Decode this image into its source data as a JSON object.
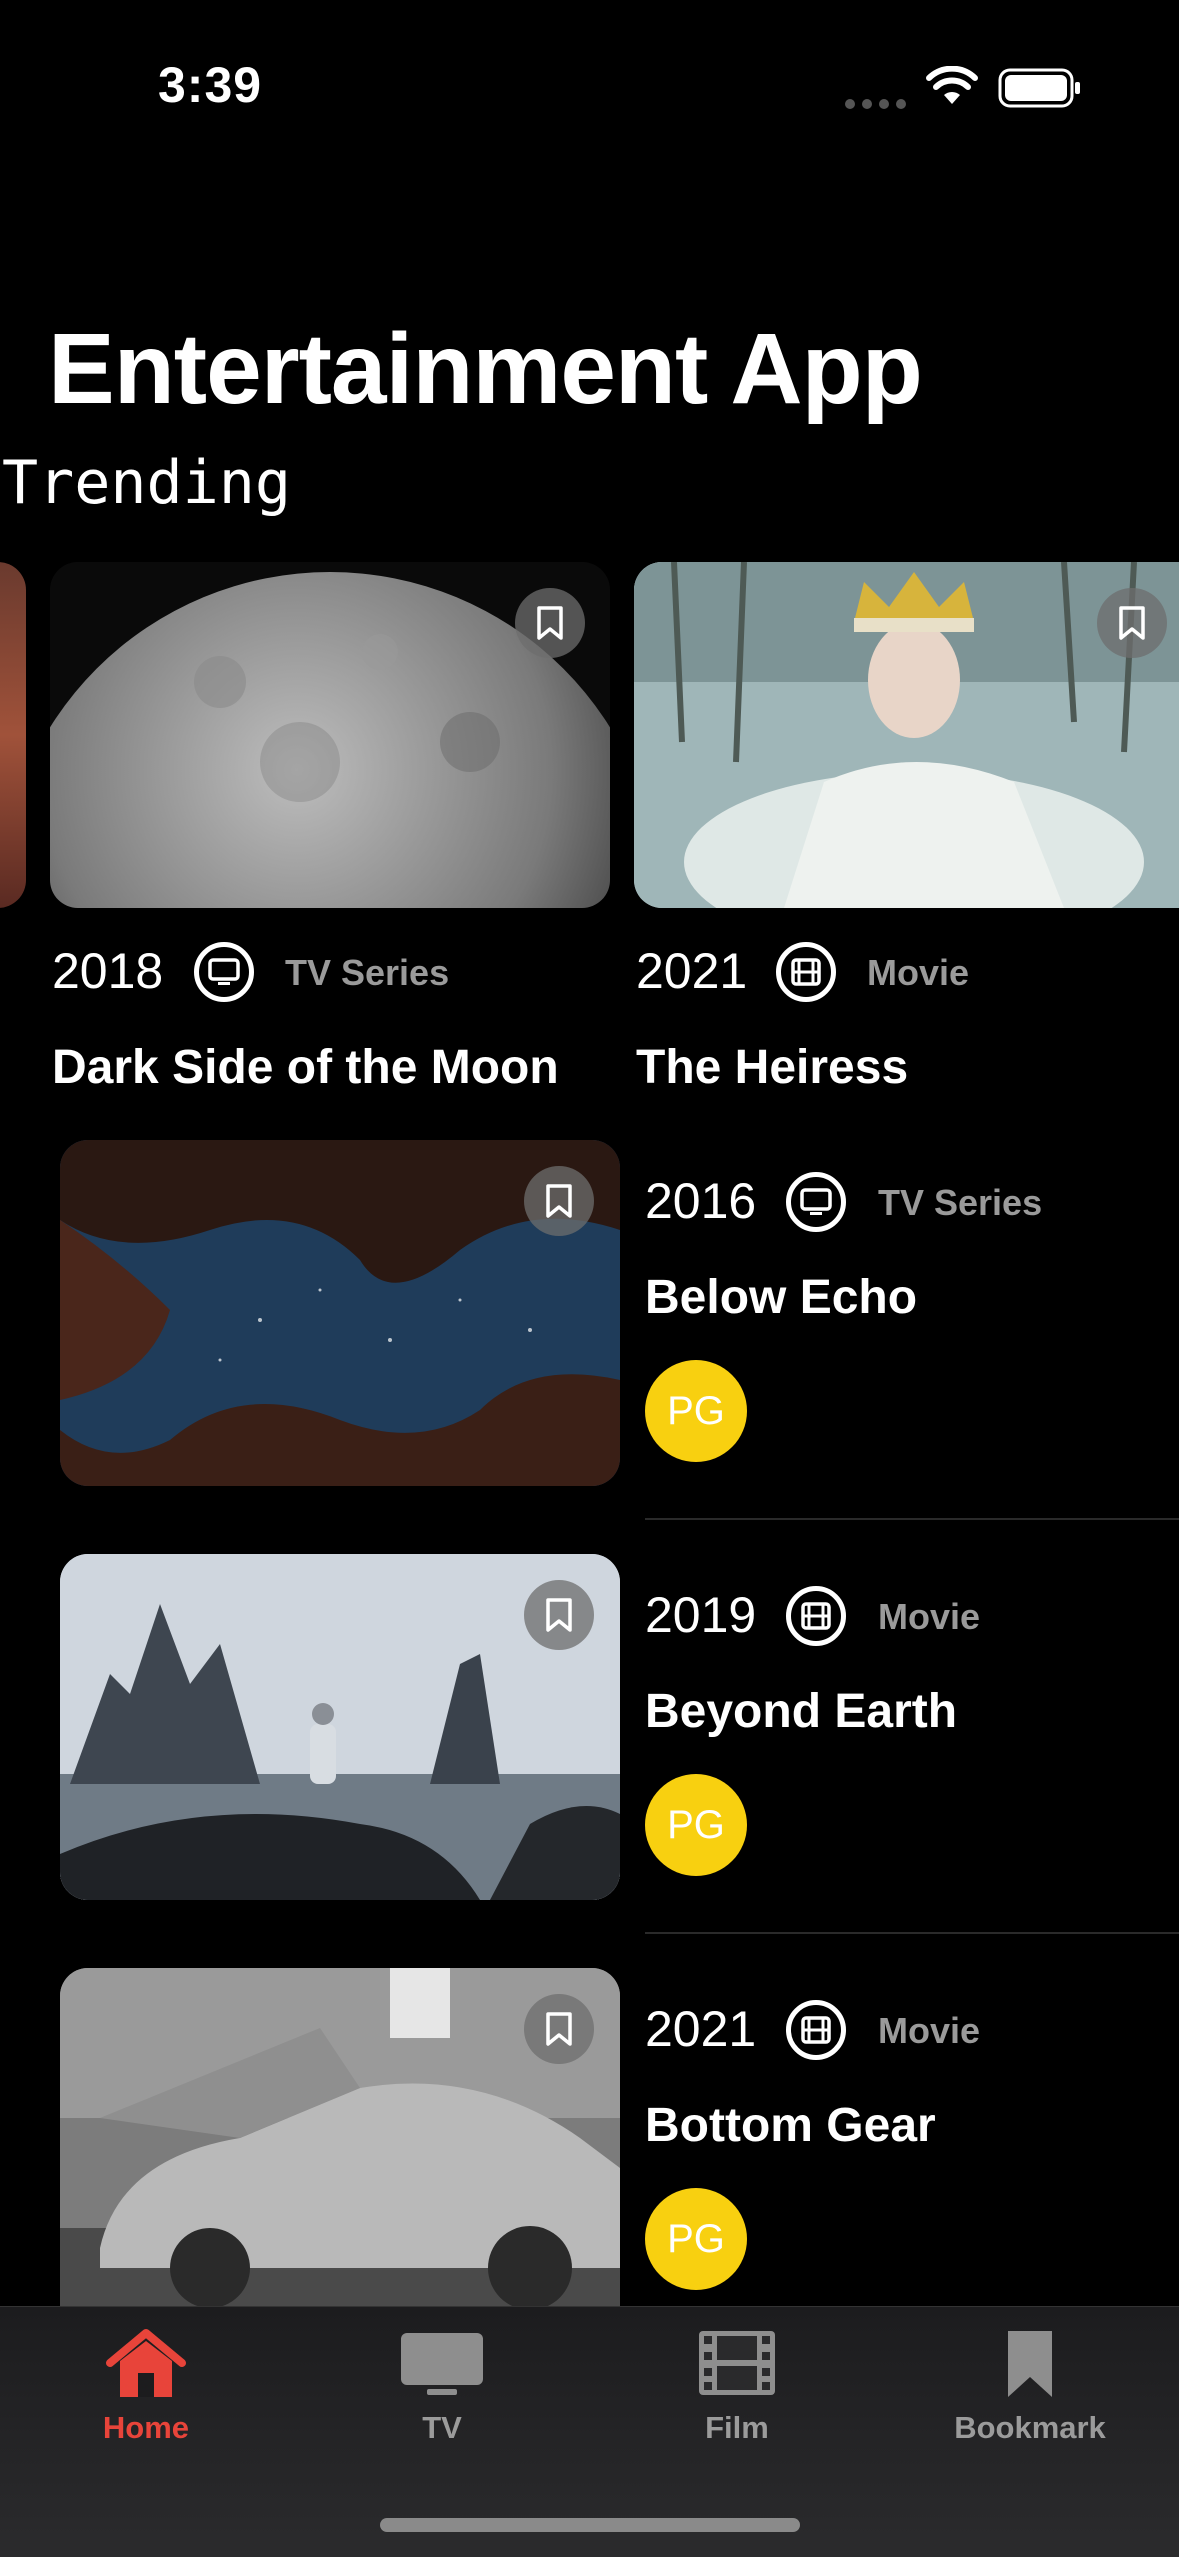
{
  "status": {
    "time": "3:39"
  },
  "app_title": "Entertainment App",
  "section_title": "Trending",
  "trending": [
    {
      "year": "2018",
      "type": "TV Series",
      "title": "Dark Side of the Moon"
    },
    {
      "year": "2021",
      "type": "Movie",
      "title": "The Heiress"
    }
  ],
  "list": [
    {
      "year": "2016",
      "type": "TV Series",
      "title": "Below Echo",
      "rating": "PG"
    },
    {
      "year": "2019",
      "type": "Movie",
      "title": "Beyond Earth",
      "rating": "PG"
    },
    {
      "year": "2021",
      "type": "Movie",
      "title": "Bottom Gear",
      "rating": "PG"
    }
  ],
  "tabs": [
    {
      "label": "Home",
      "icon": "house-icon",
      "active": true
    },
    {
      "label": "TV",
      "icon": "tv-icon",
      "active": false
    },
    {
      "label": "Film",
      "icon": "film-icon",
      "active": false
    },
    {
      "label": "Bookmark",
      "icon": "bookmark-icon",
      "active": false
    }
  ],
  "colors": {
    "accent": "#e8443a",
    "rating_badge": "#f8d010",
    "background": "#000000"
  }
}
